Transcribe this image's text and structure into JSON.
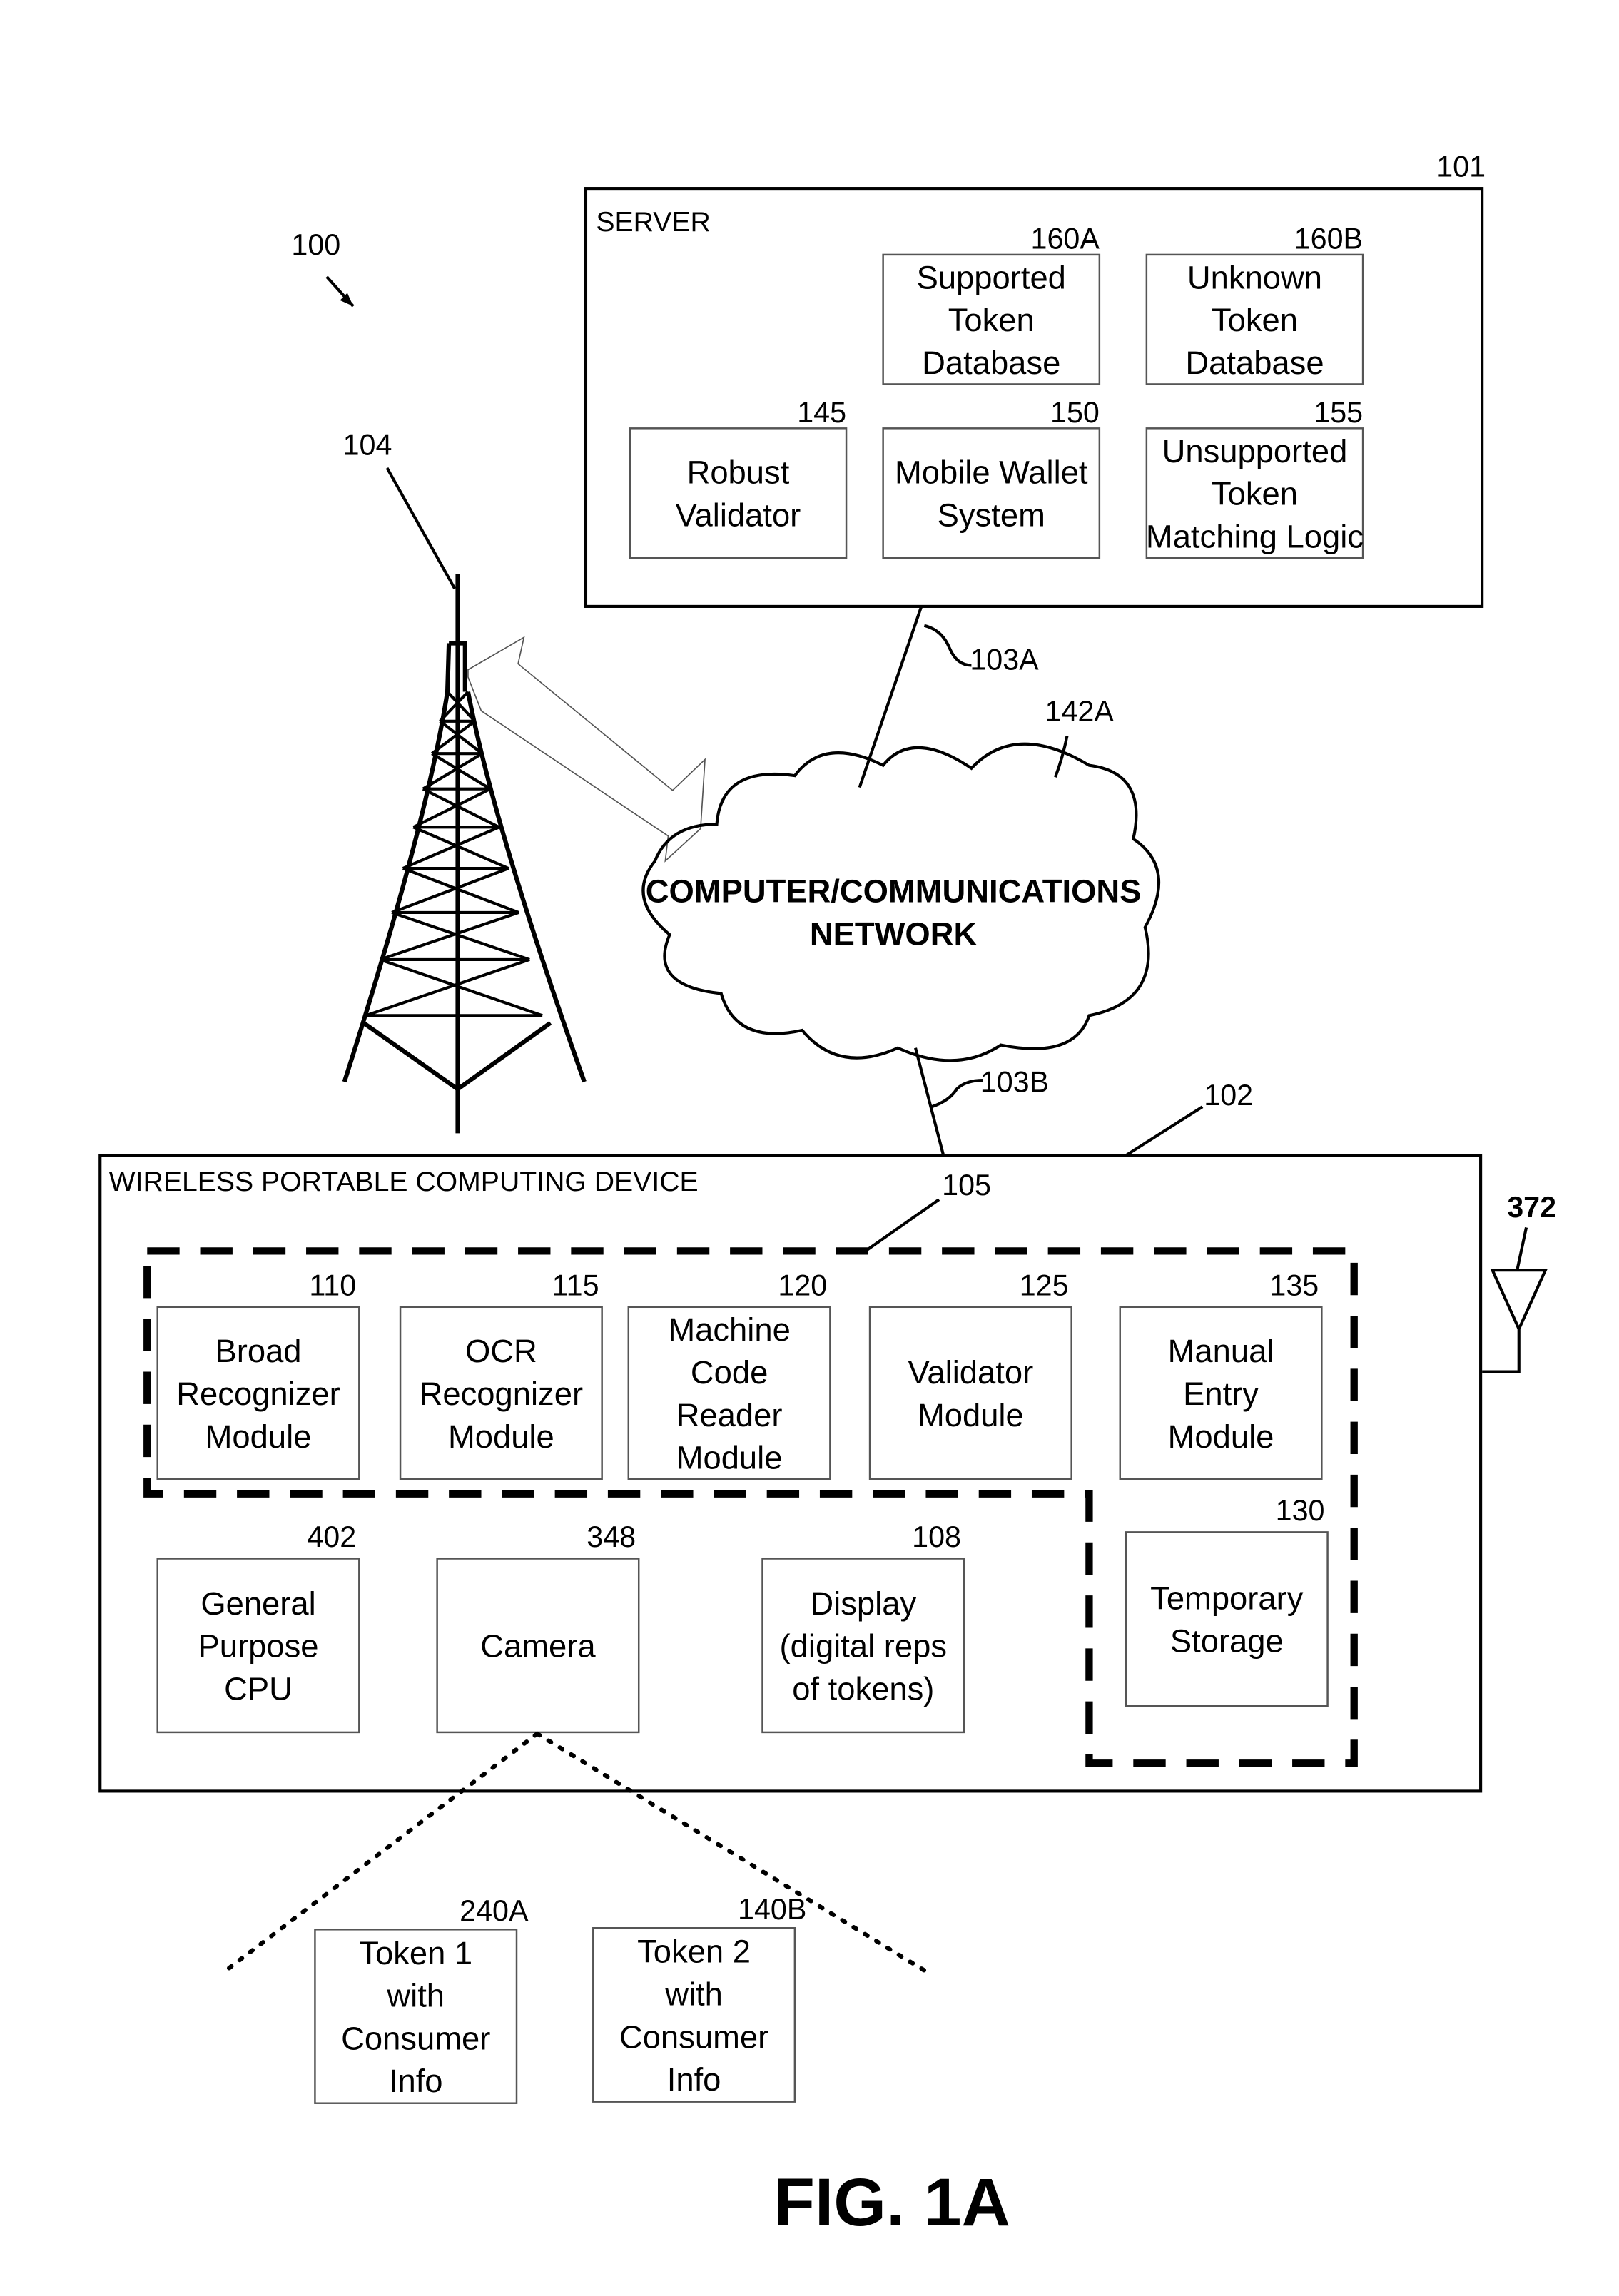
{
  "figure": {
    "label": "FIG. 1A",
    "system_ref": "100"
  },
  "server": {
    "ref": "101",
    "title": "SERVER",
    "boxes": [
      {
        "ref": "160A",
        "lines": [
          "Supported",
          "Token",
          "Database"
        ]
      },
      {
        "ref": "160B",
        "lines": [
          "Unknown",
          "Token",
          "Database"
        ]
      },
      {
        "ref": "145",
        "lines": [
          "Robust",
          "Validator"
        ]
      },
      {
        "ref": "150",
        "lines": [
          "Mobile Wallet",
          "System"
        ]
      },
      {
        "ref": "155",
        "lines": [
          "Unsupported",
          "Token",
          "Matching Logic"
        ]
      }
    ]
  },
  "tower": {
    "ref": "104"
  },
  "links": {
    "server_to_network": "103A",
    "network_to_device": "103B"
  },
  "network": {
    "ref": "142A",
    "lines": [
      "COMPUTER/COMMUNICATIONS",
      "NETWORK"
    ]
  },
  "device": {
    "ref": "102",
    "title": "WIRELESS PORTABLE COMPUTING DEVICE",
    "group_ref": "105",
    "antenna_ref": "372",
    "modules": [
      {
        "ref": "110",
        "lines": [
          "Broad",
          "Recognizer",
          "Module"
        ]
      },
      {
        "ref": "115",
        "lines": [
          "OCR",
          "Recognizer",
          "Module"
        ]
      },
      {
        "ref": "120",
        "lines": [
          "Machine",
          "Code",
          "Reader",
          "Module"
        ]
      },
      {
        "ref": "125",
        "lines": [
          "Validator",
          "Module"
        ]
      },
      {
        "ref": "135",
        "lines": [
          "Manual",
          "Entry",
          "Module"
        ]
      }
    ],
    "components": [
      {
        "ref": "402",
        "lines": [
          "General",
          "Purpose",
          "CPU"
        ]
      },
      {
        "ref": "348",
        "lines": [
          "Camera"
        ]
      },
      {
        "ref": "108",
        "lines": [
          "Display",
          "(digital reps",
          "of tokens)"
        ]
      },
      {
        "ref": "130",
        "lines": [
          "Temporary",
          "Storage"
        ]
      }
    ]
  },
  "tokens": [
    {
      "ref": "240A",
      "lines": [
        "Token 1",
        "with",
        "Consumer",
        "Info"
      ]
    },
    {
      "ref": "140B",
      "lines": [
        "Token 2",
        "with",
        "Consumer",
        "Info"
      ]
    }
  ]
}
